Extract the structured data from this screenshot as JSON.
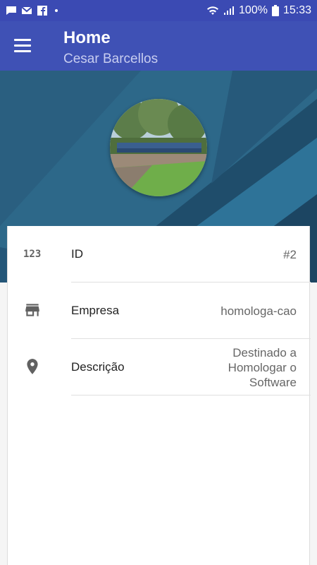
{
  "status_bar": {
    "battery": "100%",
    "time": "15:33"
  },
  "app_bar": {
    "title": "Home",
    "subtitle": "Cesar Barcellos"
  },
  "colors": {
    "status_bar": "#3b4ab3",
    "app_bar": "#3f51b5",
    "banner": "#2e6a8c",
    "icon": "#616161"
  },
  "rows": [
    {
      "icon": "numeric-123-icon",
      "label": "ID",
      "value": "#2"
    },
    {
      "icon": "store-icon",
      "label": "Empresa",
      "value": "homologa-cao"
    },
    {
      "icon": "location-pin-icon",
      "label": "Descrição",
      "value": "Destinado a Homologar o Software"
    }
  ]
}
